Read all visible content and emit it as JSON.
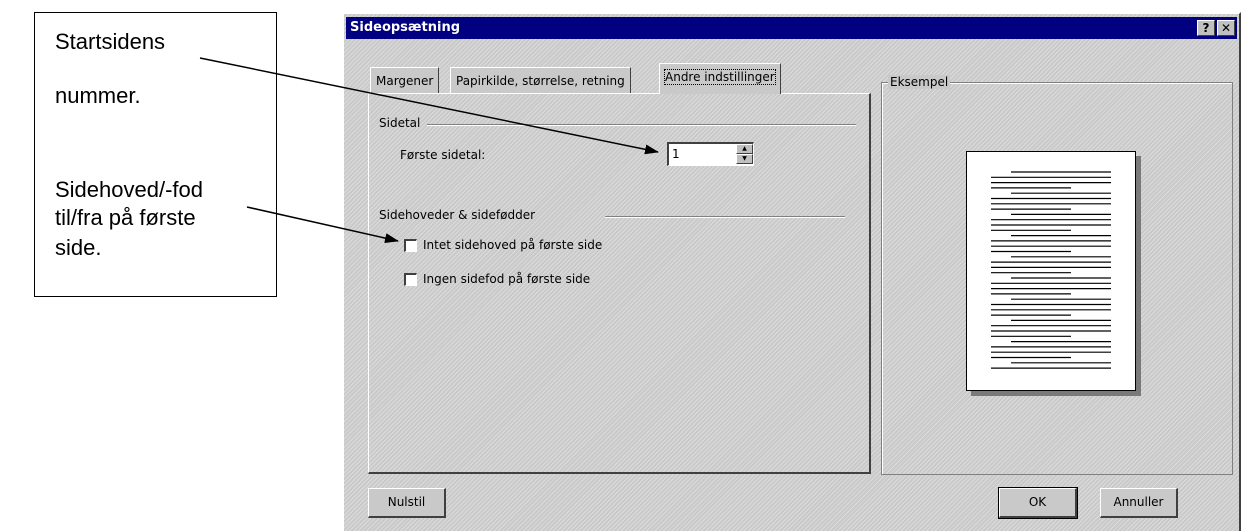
{
  "callouts": {
    "start_line1": "Startsidens",
    "start_line2": "nummer.",
    "header_line1": "Sidehoved/-fod",
    "header_line2": "til/fra på første",
    "header_line3": "side."
  },
  "dialog": {
    "title": "Sideopsætning",
    "help_button": "?",
    "close_button": "✕",
    "tabs": [
      {
        "label": "Margener"
      },
      {
        "label": "Papirkilde, størrelse, retning"
      },
      {
        "label": "Andre indstillinger"
      }
    ],
    "sidetal_group": "Sidetal",
    "first_page_label": "Første sidetal:",
    "first_page_value": "1",
    "headers_group": "Sidehoveder & sidefødder",
    "checkbox_no_header": {
      "label": "Intet sidehoved på første side",
      "checked": false
    },
    "checkbox_no_footer": {
      "label": "Ingen sidefod på første side",
      "checked": false
    },
    "preview_label": "Eksempel",
    "reset_button": "Nulstil",
    "ok_button": "OK",
    "cancel_button": "Annuller"
  },
  "colors": {
    "titlebar": "#000080",
    "dialog_bg": "#c9c9c9"
  },
  "icons": {
    "spin_up": "spin-up-icon",
    "spin_down": "spin-down-icon"
  }
}
